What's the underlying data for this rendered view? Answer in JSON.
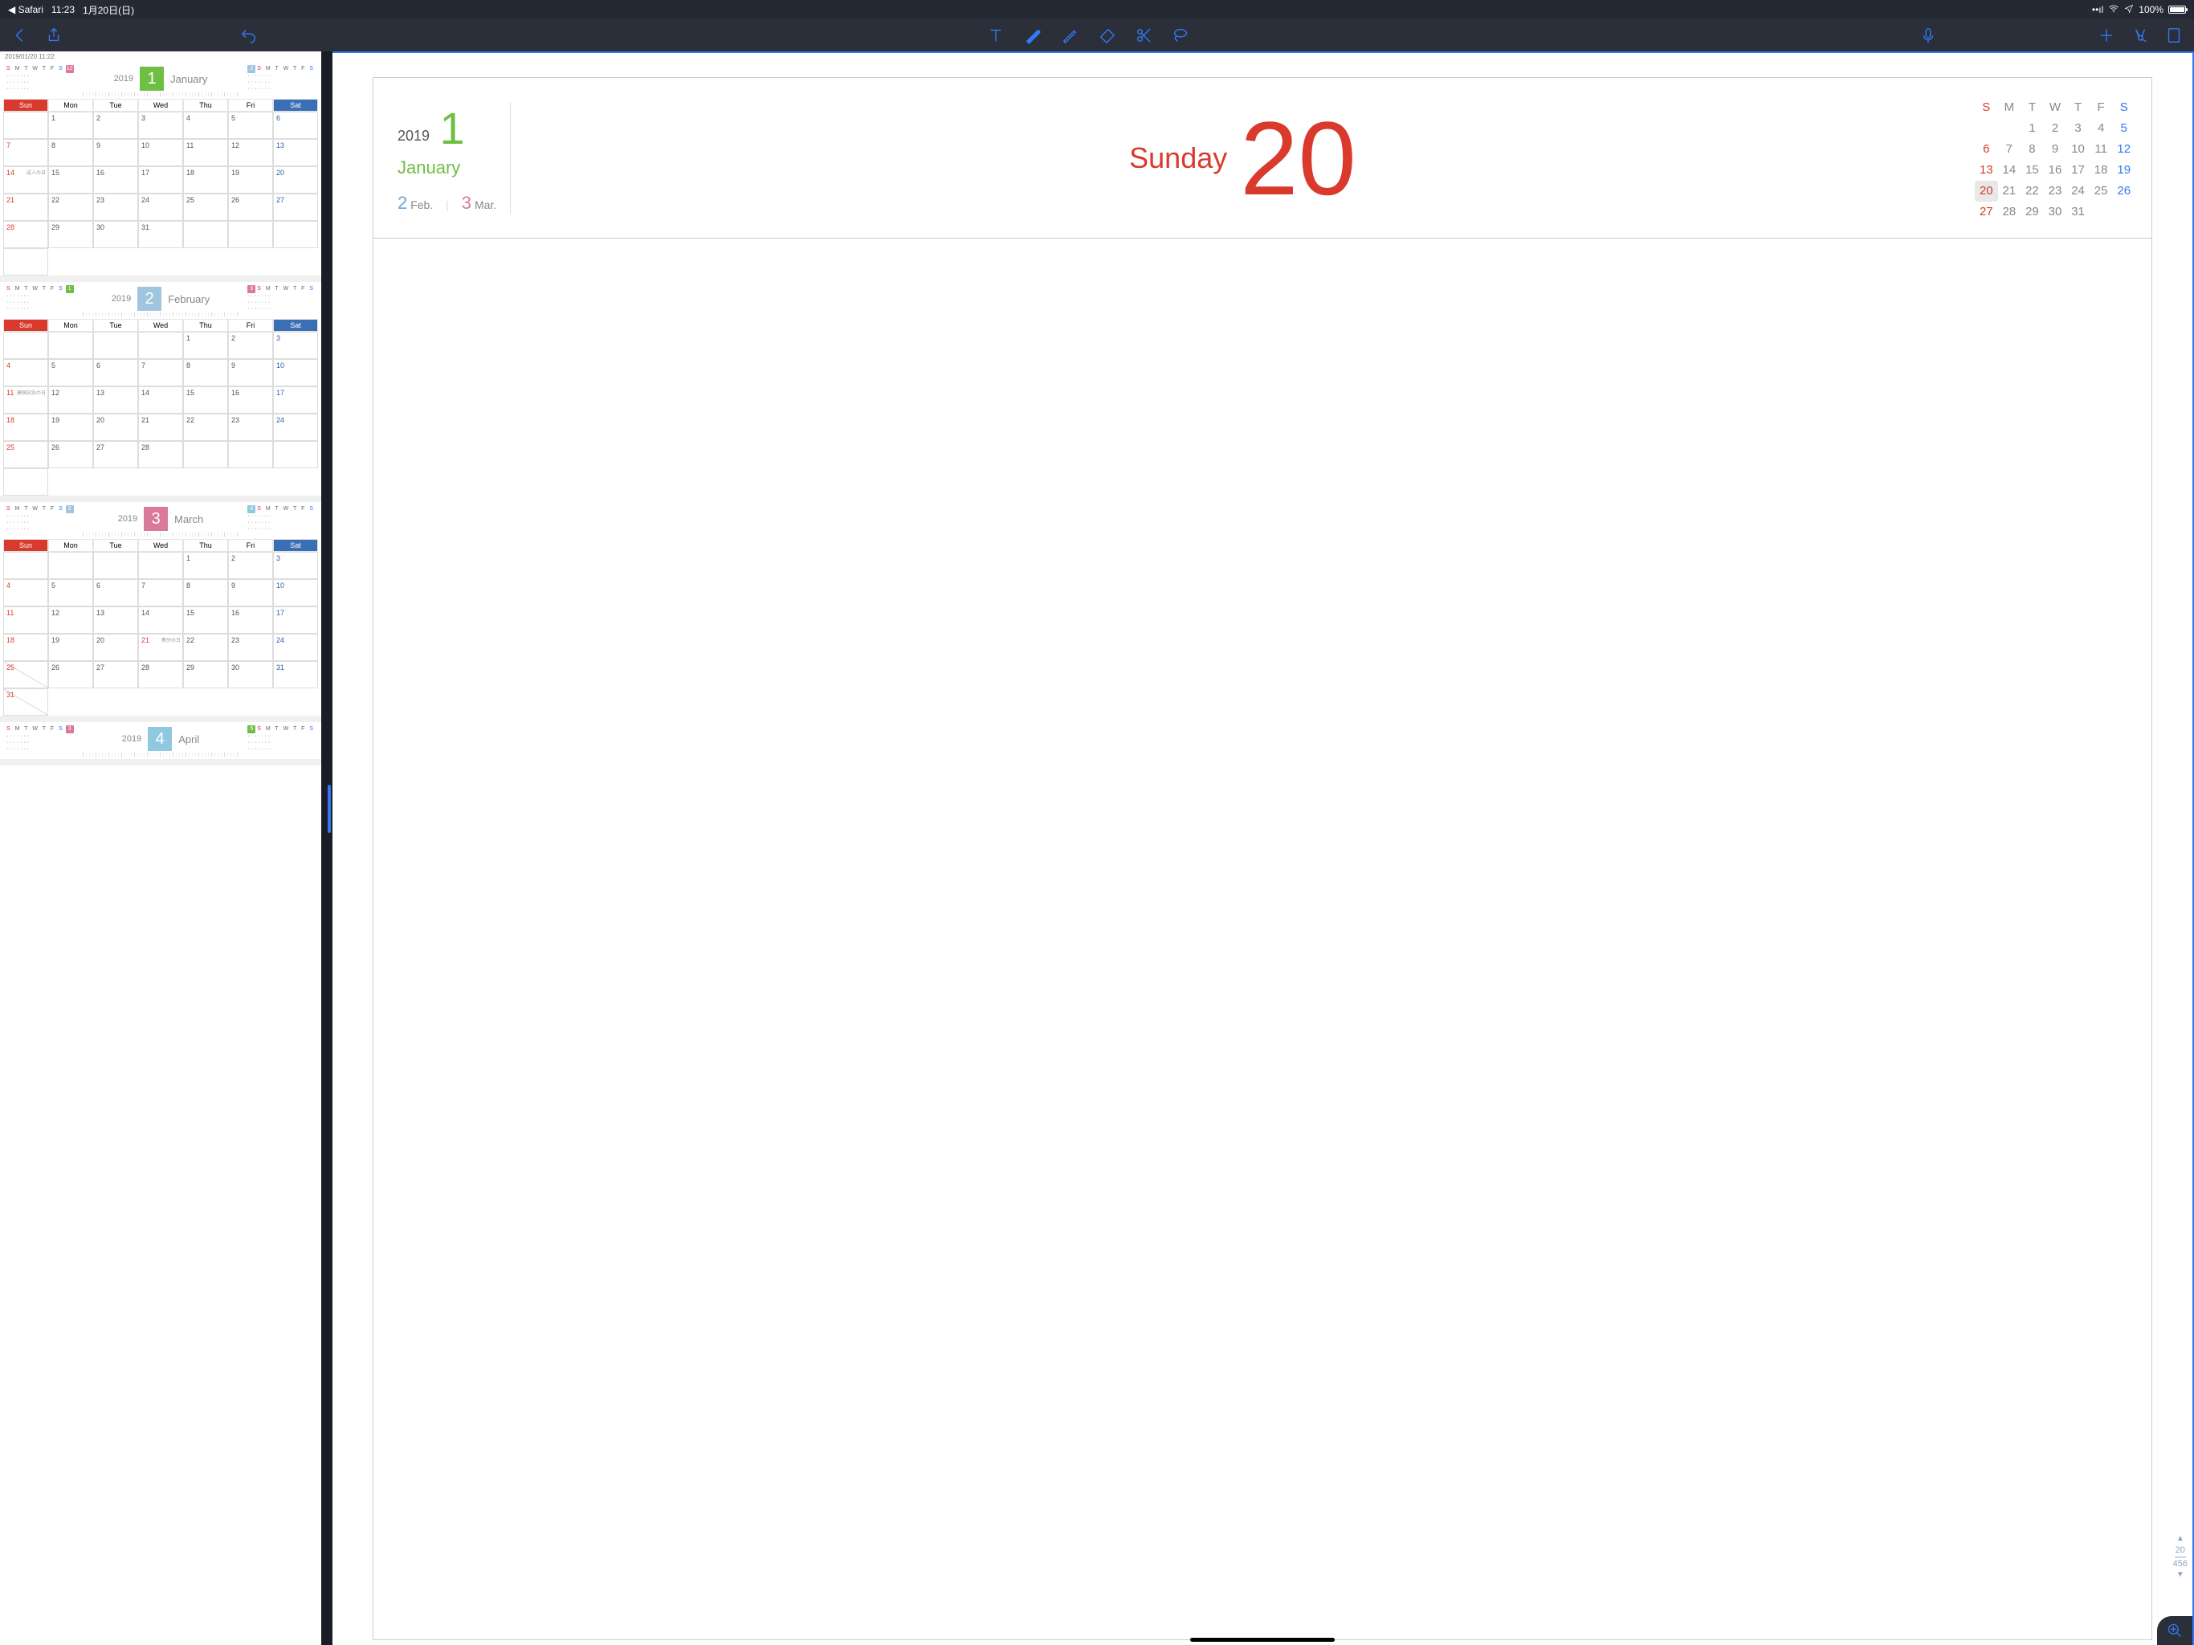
{
  "status": {
    "back_app": "Safari",
    "time": "11:23",
    "date_label": "1月20日(日)",
    "battery_pct": "100%"
  },
  "toolbar": {
    "undo_label": "Undo"
  },
  "sidebar": {
    "timestamp": "2019/01/20 11:22",
    "months": [
      {
        "num": "1",
        "name": "January",
        "year": "2019",
        "color": "#6fbf44",
        "prev_badge": "12",
        "prev_color": "#d97a9a",
        "next_badge": "2",
        "next_color": "#9fc6de"
      },
      {
        "num": "2",
        "name": "February",
        "year": "2019",
        "color": "#9fc6de",
        "prev_badge": "1",
        "prev_color": "#6fbf44",
        "next_badge": "3",
        "next_color": "#d97a9a"
      },
      {
        "num": "3",
        "name": "March",
        "year": "2019",
        "color": "#d97a9a",
        "prev_badge": "2",
        "prev_color": "#9fc6de",
        "next_badge": "4",
        "next_color": "#8fc9e0"
      },
      {
        "num": "4",
        "name": "April",
        "year": "2019",
        "color": "#8fc9e0",
        "prev_badge": "3",
        "prev_color": "#d97a9a",
        "next_badge": "5",
        "next_color": "#6fbf44"
      }
    ],
    "wk": {
      "sun": "Sun",
      "mon": "Mon",
      "tue": "Tue",
      "wed": "Wed",
      "thu": "Thu",
      "fri": "Fri",
      "sat": "Sat"
    },
    "notes": {
      "jan14": "成人の日",
      "feb11": "建国記念の日",
      "mar21": "春分の日"
    },
    "jan_cells": [
      "",
      "1",
      "2",
      "3",
      "4",
      "5",
      "6",
      "7",
      "8",
      "9",
      "10",
      "11",
      "12",
      "13",
      "14",
      "15",
      "16",
      "17",
      "18",
      "19",
      "20",
      "21",
      "22",
      "23",
      "24",
      "25",
      "26",
      "27",
      "28",
      "29",
      "30",
      "31",
      "",
      "",
      "",
      ""
    ],
    "feb_cells": [
      "",
      "",
      "",
      "",
      "1",
      "2",
      "3",
      "4",
      "5",
      "6",
      "7",
      "8",
      "9",
      "10",
      "11",
      "12",
      "13",
      "14",
      "15",
      "16",
      "17",
      "18",
      "19",
      "20",
      "21",
      "22",
      "23",
      "24",
      "25",
      "26",
      "27",
      "28",
      "",
      "",
      "",
      ""
    ],
    "mar_cells": [
      "",
      "",
      "",
      "",
      "1",
      "2",
      "3",
      "4",
      "5",
      "6",
      "7",
      "8",
      "9",
      "10",
      "11",
      "12",
      "13",
      "14",
      "15",
      "16",
      "17",
      "18",
      "19",
      "20",
      "21",
      "22",
      "23",
      "24",
      "25",
      "26",
      "27",
      "28",
      "29",
      "30",
      "31",
      ""
    ]
  },
  "page": {
    "year": "2019",
    "month_num": "1",
    "month_name": "January",
    "next2": {
      "n1": "2",
      "l1": "Feb.",
      "n2": "3",
      "l2": "Mar."
    },
    "day_name": "Sunday",
    "day_num": "20",
    "minical": {
      "hdr": [
        "S",
        "M",
        "T",
        "W",
        "T",
        "F",
        "S"
      ],
      "rows": [
        [
          "",
          "",
          "1",
          "2",
          "3",
          "4",
          "5"
        ],
        [
          "6",
          "7",
          "8",
          "9",
          "10",
          "11",
          "12"
        ],
        [
          "13",
          "14",
          "15",
          "16",
          "17",
          "18",
          "19"
        ],
        [
          "20",
          "21",
          "22",
          "23",
          "24",
          "25",
          "26"
        ],
        [
          "27",
          "28",
          "29",
          "30",
          "31",
          "",
          ""
        ]
      ],
      "today": "20"
    },
    "nav": {
      "current": "20",
      "total": "456"
    }
  }
}
